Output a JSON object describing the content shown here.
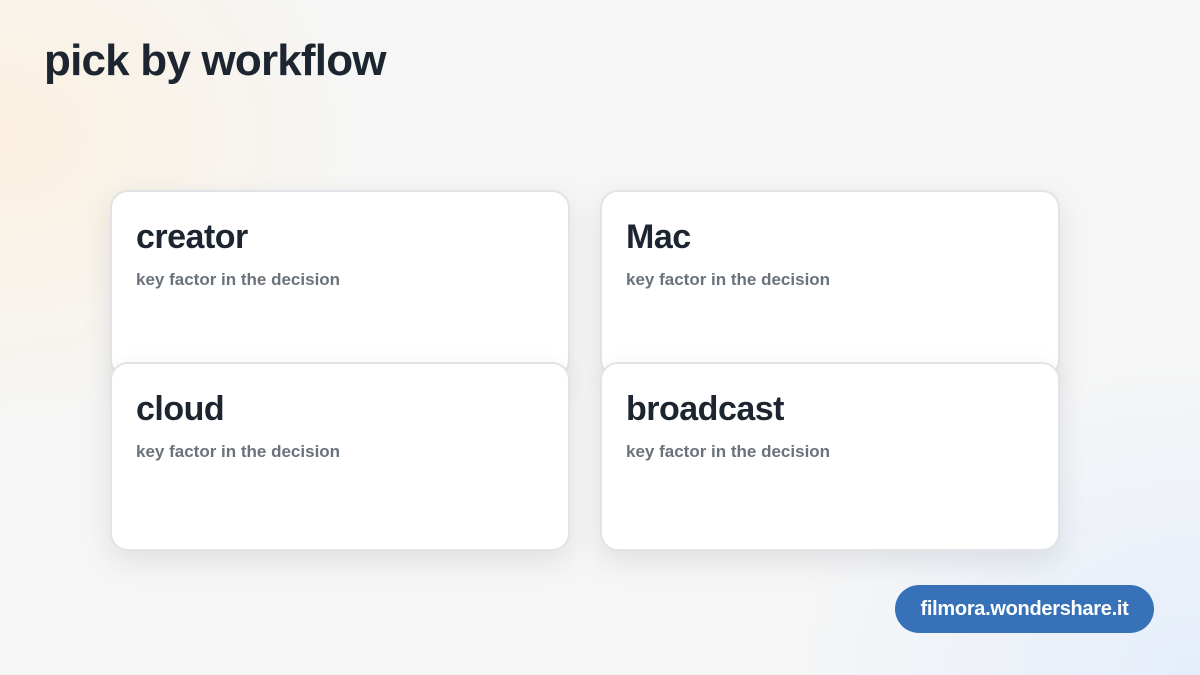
{
  "page": {
    "title": "pick by workflow"
  },
  "cards": [
    {
      "title": "creator",
      "subtitle": "key factor in the decision"
    },
    {
      "title": "Mac",
      "subtitle": "key factor in the decision"
    },
    {
      "title": "cloud",
      "subtitle": "key factor in the decision"
    },
    {
      "title": "broadcast",
      "subtitle": "key factor in the decision"
    }
  ],
  "badge": {
    "label": "filmora.wondershare.it"
  },
  "colors": {
    "text_primary": "#1c2530",
    "text_secondary": "#6a727b",
    "badge_background": "#3772b9",
    "card_background": "#ffffff"
  }
}
